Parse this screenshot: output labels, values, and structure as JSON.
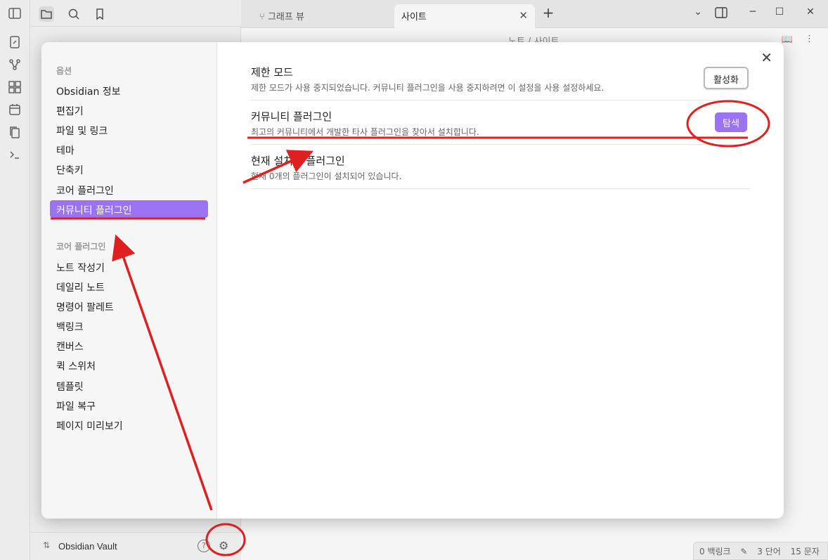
{
  "tabs": [
    {
      "label": "그래프 뷰",
      "icon": "graph-icon"
    },
    {
      "label": "사이트",
      "icon": "",
      "active": true
    }
  ],
  "breadcrumb": "노트 / 사이트",
  "vault": {
    "name": "Obsidian Vault"
  },
  "status": {
    "backlinks": "0 백링크",
    "words": "3 단어",
    "chars": "15 문자"
  },
  "sidebar": {
    "heading_options": "옵션",
    "options": [
      "Obsidian 정보",
      "편집기",
      "파일 및 링크",
      "테마",
      "단축키",
      "코어 플러그인",
      "커뮤니티 플러그인"
    ],
    "active_index": 6,
    "heading_core": "코어 플러그인",
    "core": [
      "노트 작성기",
      "데일리 노트",
      "명령어 팔레트",
      "백링크",
      "캔버스",
      "퀵 스위처",
      "템플릿",
      "파일 복구",
      "페이지 미리보기"
    ]
  },
  "settings": [
    {
      "name": "제한 모드",
      "desc": "제한 모드가 사용 중지되었습니다. 커뮤니티 플러그인을 사용 중지하려면 이 설정을 사용 설정하세요.",
      "button": "활성화"
    },
    {
      "name": "커뮤니티 플러그인",
      "desc": "최고의 커뮤니티에서 개발한 타사 플러그인을 찾아서 설치합니다.",
      "button": "탐색"
    },
    {
      "name": "현재 설치된 플러그인",
      "desc": "현재 0개의 플러그인이 설치되어 있습니다."
    }
  ],
  "colors": {
    "accent": "#9b72f2",
    "annotation": "#e02020"
  }
}
